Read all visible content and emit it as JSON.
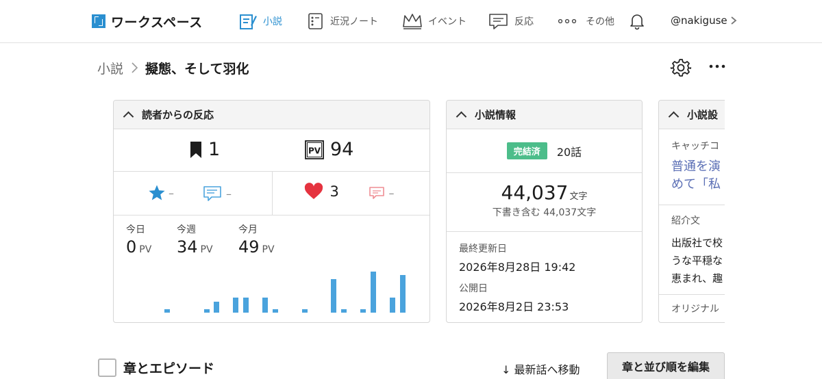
{
  "header": {
    "brand": "ワークスペース",
    "nav": [
      {
        "label": "小説",
        "icon": "novel-icon",
        "active": true
      },
      {
        "label": "近況ノート",
        "icon": "notebook-icon",
        "active": false
      },
      {
        "label": "イベント",
        "icon": "crown-icon",
        "active": false
      },
      {
        "label": "反応",
        "icon": "comment-icon",
        "active": false
      },
      {
        "label": "その他",
        "icon": "more-dots-icon",
        "active": false
      }
    ],
    "username": "@nakiguse",
    "accent": "#2a8fd0"
  },
  "breadcrumb": {
    "parent": "小説",
    "title": "擬態、そして羽化"
  },
  "reactions": {
    "heading": "読者からの反応",
    "bookmarks": "1",
    "pv_total": "94",
    "stars": "–",
    "reviews": "–",
    "hearts": "3",
    "comments": "–",
    "periods": [
      {
        "label": "今日",
        "value": "0",
        "unit": "PV"
      },
      {
        "label": "今週",
        "value": "34",
        "unit": "PV"
      },
      {
        "label": "今月",
        "value": "49",
        "unit": "PV"
      }
    ]
  },
  "chart_data": {
    "type": "bar",
    "title": "",
    "xlabel": "",
    "ylabel": "",
    "values": [
      0,
      1,
      0,
      0,
      0,
      1,
      3,
      0,
      4,
      4,
      0,
      4,
      1,
      0,
      0,
      1,
      0,
      0,
      9,
      1,
      0,
      1,
      11,
      0,
      4,
      10
    ],
    "ylim": [
      0,
      12
    ],
    "color": "#4aa3dd"
  },
  "novel_info": {
    "heading": "小説情報",
    "status": "完結済",
    "episodes": "20話",
    "char_count": "44,037",
    "char_unit": "文字",
    "char_sub": "下書き含む 44,037文字",
    "updated_label": "最終更新日",
    "updated": "2026年8月28日 19:42",
    "published_label": "公開日",
    "published": "2026年8月2日 23:53",
    "badge_color": "#4cbd8a"
  },
  "novel_detail": {
    "heading": "小説設",
    "catch_label": "キャッチコ",
    "catch_line1": "普通を演",
    "catch_line2": "めて「私",
    "intro_label": "紹介文",
    "intro_line1": "出版社で校",
    "intro_line2": "うな平穏な",
    "intro_line3": "恵まれ、趣",
    "original_label": "オリジナル"
  },
  "chapters": {
    "title": "章とエピソード",
    "latest_link": "↓ 最新話へ移動",
    "edit_button": "章と並び順を編集"
  }
}
